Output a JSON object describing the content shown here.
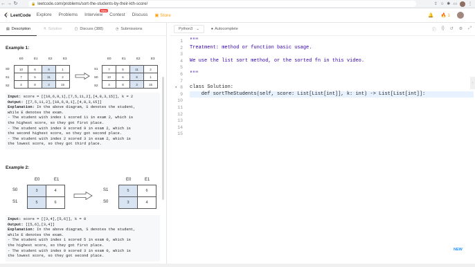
{
  "browser": {
    "url": "leetcode.com/problems/sort-the-students-by-their-kth-score/"
  },
  "header": {
    "logo": "LeetCode",
    "nav": [
      "Explore",
      "Problems",
      "Interview",
      "Contest",
      "Discuss"
    ],
    "badge": "New",
    "store": "Store",
    "streak": "1"
  },
  "tabs": {
    "description": "Description",
    "solution": "Solution",
    "discuss": "Discuss (388)",
    "submissions": "Submissions"
  },
  "example1": {
    "title": "Example 1:",
    "headers": [
      "E0",
      "E1",
      "E2",
      "E3"
    ],
    "rows_before": [
      [
        "S0",
        "10",
        "6",
        "9",
        "1"
      ],
      [
        "S1",
        "7",
        "5",
        "11",
        "2"
      ],
      [
        "S2",
        "4",
        "8",
        "3",
        "15"
      ]
    ],
    "rows_after": [
      [
        "S1",
        "7",
        "5",
        "11",
        "2"
      ],
      [
        "S0",
        "10",
        "6",
        "9",
        "1"
      ],
      [
        "S2",
        "4",
        "8",
        "3",
        "15"
      ]
    ],
    "input_label": "Input:",
    "input": " score = [[10,6,9,1],[7,5,11,2],[4,8,3,15]], k = 2",
    "output_label": "Output:",
    "output": " [[7,5,11,2],[10,6,9,1],[4,8,3,15]]",
    "explanation_label": "Explanation:",
    "explanation": [
      " In the above diagram, S denotes the student,",
      "while E denotes the exam.",
      "- The student with index 1 scored 11 in exam 2, which is",
      "the highest score, so they got first place.",
      "- The student with index 0 scored 9 in exam 2, which is",
      "the second highest score, so they got second place.",
      "- The student with index 2 scored 3 in exam 2, which is",
      "the lowest score, so they got third place."
    ]
  },
  "example2": {
    "title": "Example 2:",
    "headers": [
      "E0",
      "E1"
    ],
    "rows_before": [
      [
        "S0",
        "3",
        "4"
      ],
      [
        "S1",
        "5",
        "6"
      ]
    ],
    "rows_after": [
      [
        "S1",
        "5",
        "6"
      ],
      [
        "S0",
        "3",
        "4"
      ]
    ],
    "input_label": "Input:",
    "input": " score = [[3,4],[5,6]], k = 0",
    "output_label": "Output:",
    "output": " [[5,6],[3,4]]",
    "explanation_label": "Explanation:",
    "explanation": [
      " In the above diagram, S denotes the student,",
      "while E denotes the exam.",
      "- The student with index 1 scored 5 in exam 0, which is",
      "the highest score, so they got first place.",
      "- The student with index 0 scored 3 in exam 0, which is",
      "the lowest score, so they got second place."
    ]
  },
  "editor": {
    "language": "Python3",
    "autocomplete": "Autocomplete",
    "line_numbers": [
      "1",
      "2",
      "3",
      "4",
      "5",
      "6",
      "7",
      "8",
      "9",
      "10",
      "11",
      "12",
      "13",
      "14",
      "15"
    ],
    "lines": [
      "\"\"\"",
      "Treatment: method or function basic usage.",
      "",
      "We use the list sort method, or the sorted fn in this video.",
      "",
      "\"\"\"",
      "",
      "class Solution:",
      "    def sortTheStudents(self, score: List[List[int]], k: int) -> List[List[int]]:",
      "",
      "",
      "",
      "",
      "",
      ""
    ],
    "new_badge": "NEW"
  }
}
